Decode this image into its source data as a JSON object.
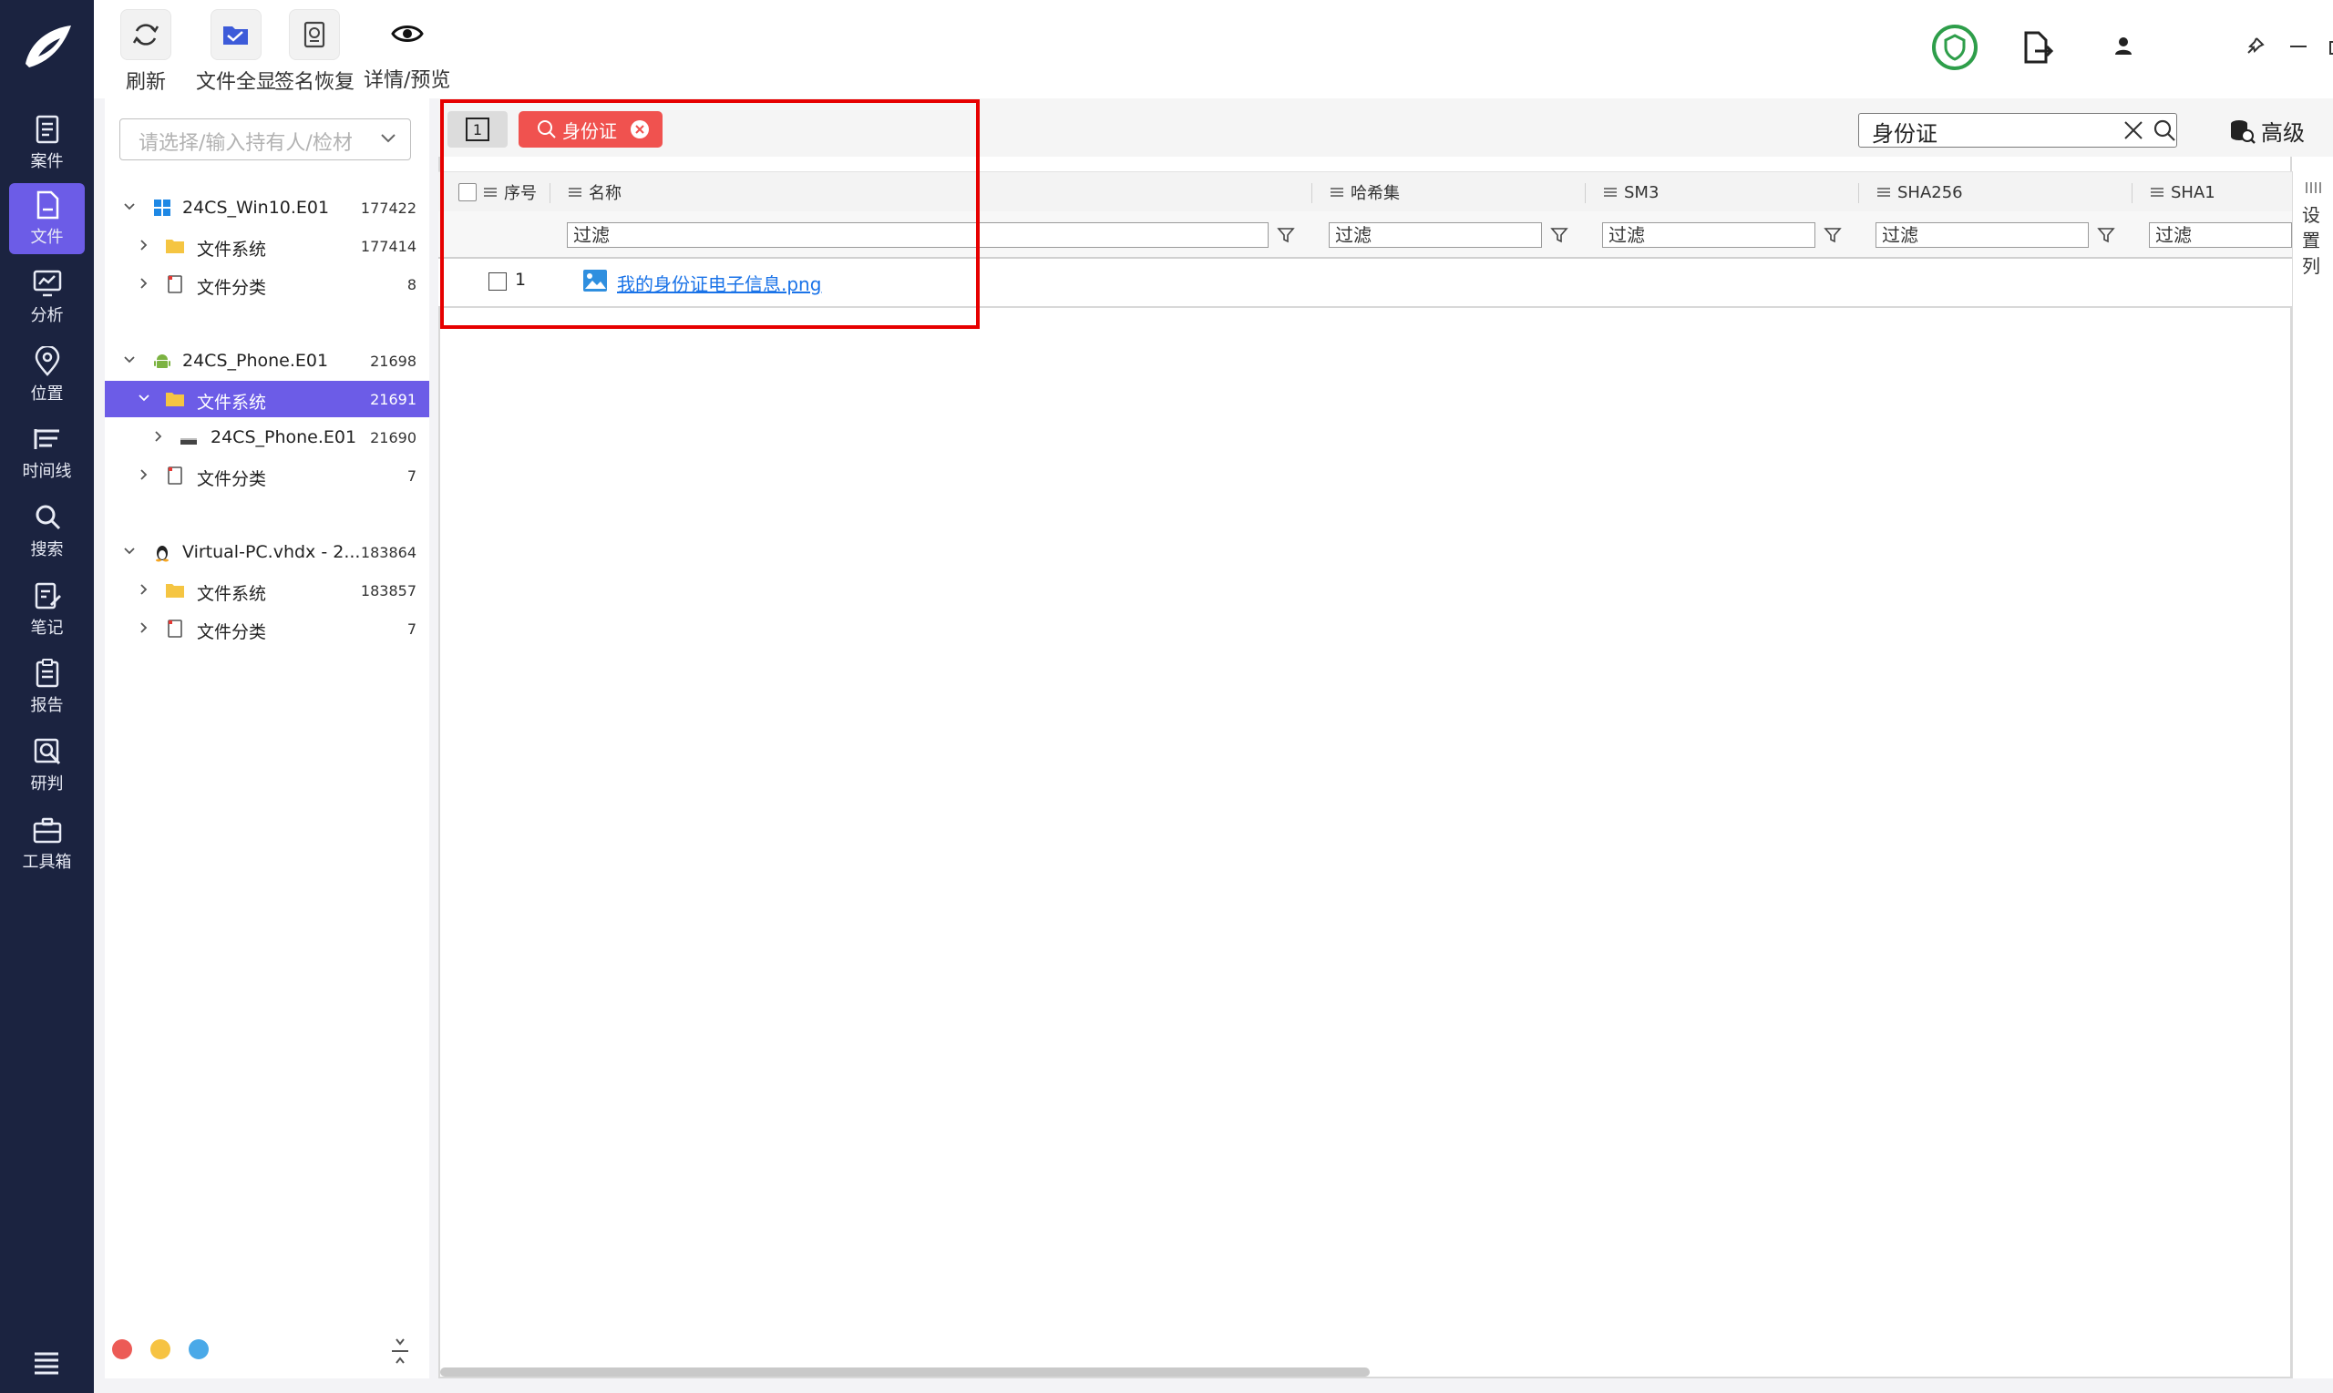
{
  "nav": {
    "items": [
      {
        "label": "案件",
        "icon": "case-icon"
      },
      {
        "label": "文件",
        "icon": "file-icon",
        "active": true
      },
      {
        "label": "分析",
        "icon": "analysis-icon"
      },
      {
        "label": "位置",
        "icon": "location-icon"
      },
      {
        "label": "时间线",
        "icon": "timeline-icon"
      },
      {
        "label": "搜索",
        "icon": "search-icon"
      },
      {
        "label": "笔记",
        "icon": "note-icon"
      },
      {
        "label": "报告",
        "icon": "report-icon"
      },
      {
        "label": "研判",
        "icon": "judge-icon"
      },
      {
        "label": "工具箱",
        "icon": "toolbox-icon"
      }
    ]
  },
  "toolbar": {
    "refresh": "刷新",
    "show_all_files": "文件全显",
    "signature_recovery": "签名恢复",
    "detail_preview": "详情/预览"
  },
  "tree": {
    "holder_placeholder": "请选择/输入持有人/检材",
    "nodes": [
      {
        "label": "24CS_Win10.E01",
        "count": "177422"
      },
      {
        "label": "文件系统",
        "count": "177414"
      },
      {
        "label": "文件分类",
        "count": "8"
      },
      {
        "label": "24CS_Phone.E01",
        "count": "21698"
      },
      {
        "label": "文件系统",
        "count": "21691"
      },
      {
        "label": "24CS_Phone.E01",
        "count": "21690"
      },
      {
        "label": "文件分类",
        "count": "7"
      },
      {
        "label": "Virtual-PC.vhdx - 2...",
        "count": "183864"
      },
      {
        "label": "文件系统",
        "count": "183857"
      },
      {
        "label": "文件分类",
        "count": "7"
      }
    ]
  },
  "search": {
    "tab_number": "1",
    "chip_label": "身份证",
    "query": "身份证",
    "advanced": "高级"
  },
  "grid": {
    "columns": [
      "序号",
      "名称",
      "哈希集",
      "SM3",
      "SHA256",
      "SHA1"
    ],
    "filter_placeholder": "过滤",
    "rows": [
      {
        "index": "1",
        "name": "我的身份证电子信息.png"
      }
    ],
    "set_columns": "设置列"
  },
  "colors": {
    "nav_bg": "#1b2340",
    "accent": "#6c5ce7",
    "chip": "#f0524f",
    "highlight": "#e60000",
    "link": "#1a73e8"
  }
}
